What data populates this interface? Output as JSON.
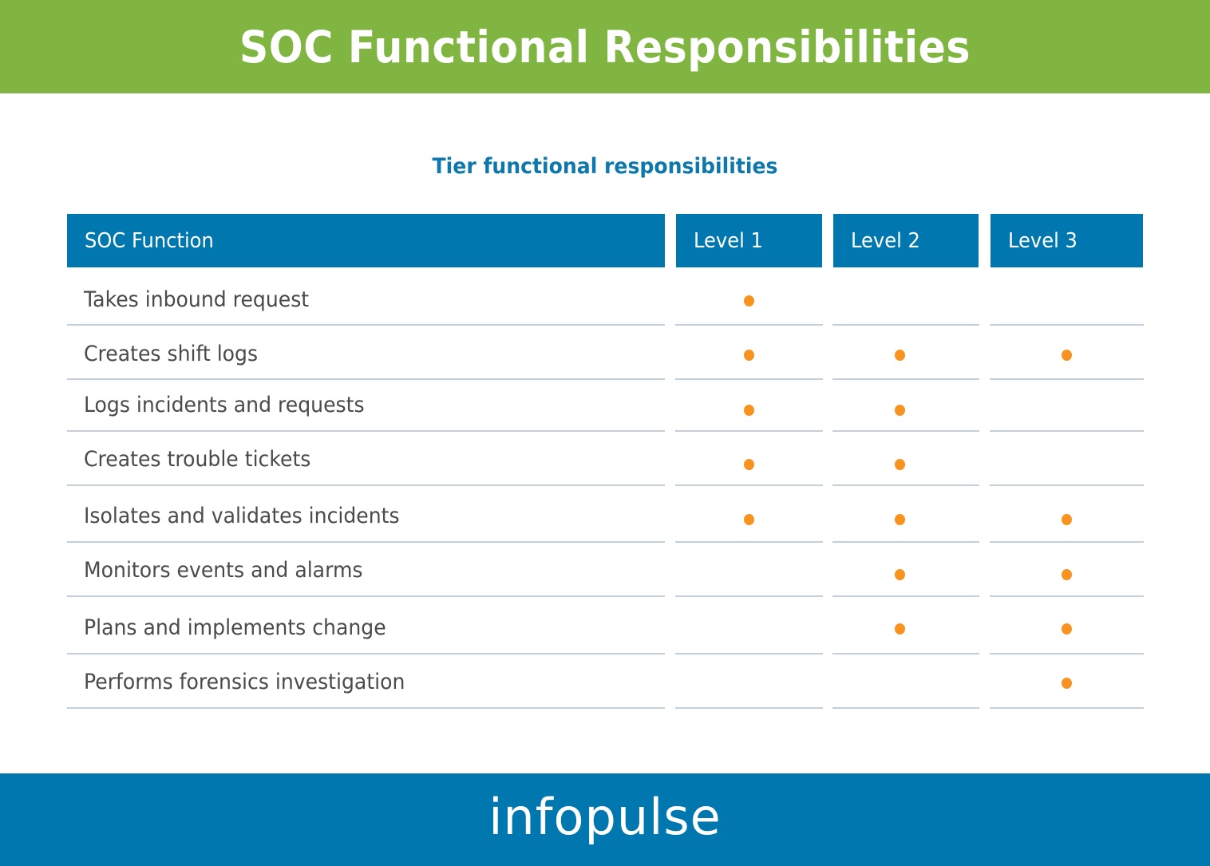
{
  "header": {
    "title": "SOC Functional Responsibilities",
    "background_color": "#80b541"
  },
  "table": {
    "caption": "Tier functional responsibilities",
    "header_color": "#0077ae",
    "marker_color": "#f7931e",
    "columns": [
      "SOC Function",
      "Level 1",
      "Level 2",
      "Level 3"
    ],
    "rows": [
      {
        "function": "Takes inbound request",
        "level1": true,
        "level2": false,
        "level3": false
      },
      {
        "function": "Creates shift logs",
        "level1": true,
        "level2": true,
        "level3": true
      },
      {
        "function": "Logs incidents and requests",
        "level1": true,
        "level2": true,
        "level3": false
      },
      {
        "function": "Creates trouble tickets",
        "level1": true,
        "level2": true,
        "level3": false
      },
      {
        "function": "Isolates and validates incidents",
        "level1": true,
        "level2": true,
        "level3": true
      },
      {
        "function": "Monitors events and alarms",
        "level1": false,
        "level2": true,
        "level3": true
      },
      {
        "function": "Plans and implements change",
        "level1": false,
        "level2": true,
        "level3": true
      },
      {
        "function": "Performs forensics investigation",
        "level1": false,
        "level2": false,
        "level3": true
      }
    ]
  },
  "footer": {
    "logo_text": "infopulse",
    "background_color": "#0077ae"
  }
}
